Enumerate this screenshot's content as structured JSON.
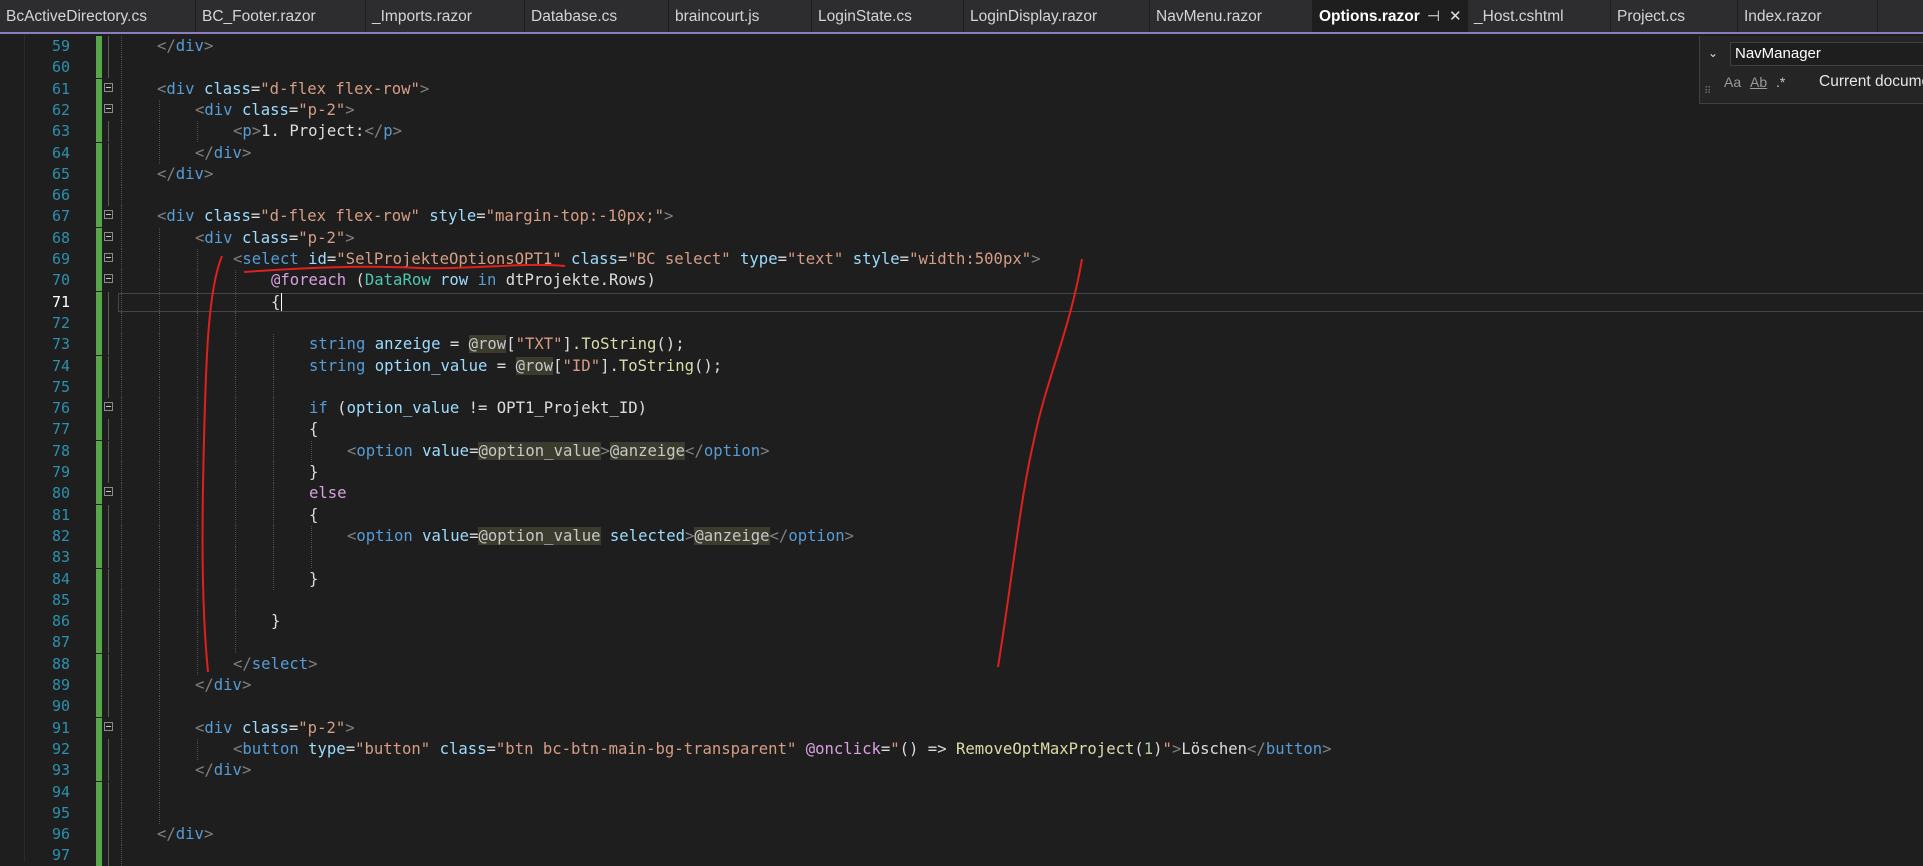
{
  "tabs": [
    {
      "label": "BcActiveDirectory.cs",
      "width": 196
    },
    {
      "label": "BC_Footer.razor",
      "width": 170
    },
    {
      "label": "_Imports.razor",
      "width": 159
    },
    {
      "label": "Database.cs",
      "width": 144
    },
    {
      "label": "braincourt.js",
      "width": 143
    },
    {
      "label": "LoginState.cs",
      "width": 152
    },
    {
      "label": "LoginDisplay.razor",
      "width": 186
    },
    {
      "label": "NavMenu.razor",
      "width": 163
    },
    {
      "label": "Options.razor",
      "width": 155,
      "active": true,
      "pin": "⊣",
      "close": "✕"
    },
    {
      "label": "_Host.cshtml",
      "width": 143
    },
    {
      "label": "Project.cs",
      "width": 127
    },
    {
      "label": "Index.razor",
      "width": 140
    }
  ],
  "find_widget": {
    "search_value": "NavManager",
    "match_case_label": "Aa",
    "whole_word_label": "Ab",
    "regex_label": ".*",
    "scope_label": "Current docume",
    "chevron": "⌄"
  },
  "editor": {
    "current_line": 71,
    "lines": [
      {
        "n": 59,
        "indent": [
          1
        ],
        "tokens": [
          [
            "t-br",
            "</"
          ],
          [
            "t-tag",
            "div"
          ],
          [
            "t-br",
            ">"
          ]
        ],
        "col": 0
      },
      {
        "n": 60,
        "indent": [
          1
        ],
        "tokens": []
      },
      {
        "n": 61,
        "indent": [
          1
        ],
        "fold": true,
        "col": 0,
        "tokens": [
          [
            "t-br",
            "<"
          ],
          [
            "t-tag",
            "div"
          ],
          [
            "t-pl",
            " "
          ],
          [
            "t-attr",
            "class"
          ],
          [
            "t-pl",
            "="
          ],
          [
            "t-str",
            "\"d-flex flex-row\""
          ],
          [
            "t-br",
            ">"
          ]
        ]
      },
      {
        "n": 62,
        "indent": [
          1,
          2
        ],
        "fold": true,
        "col": 1,
        "tokens": [
          [
            "t-br",
            "<"
          ],
          [
            "t-tag",
            "div"
          ],
          [
            "t-pl",
            " "
          ],
          [
            "t-attr",
            "class"
          ],
          [
            "t-pl",
            "="
          ],
          [
            "t-str",
            "\"p-2\""
          ],
          [
            "t-br",
            ">"
          ]
        ]
      },
      {
        "n": 63,
        "indent": [
          1,
          2,
          3
        ],
        "col": 2,
        "tokens": [
          [
            "t-br",
            "<"
          ],
          [
            "t-tag",
            "p"
          ],
          [
            "t-br",
            ">"
          ],
          [
            "t-pl",
            "1. Project:"
          ],
          [
            "t-br",
            "</"
          ],
          [
            "t-tag",
            "p"
          ],
          [
            "t-br",
            ">"
          ]
        ]
      },
      {
        "n": 64,
        "indent": [
          1,
          2
        ],
        "col": 1,
        "tokens": [
          [
            "t-br",
            "</"
          ],
          [
            "t-tag",
            "div"
          ],
          [
            "t-br",
            ">"
          ]
        ]
      },
      {
        "n": 65,
        "indent": [
          1
        ],
        "col": 0,
        "tokens": [
          [
            "t-br",
            "</"
          ],
          [
            "t-tag",
            "div"
          ],
          [
            "t-br",
            ">"
          ]
        ]
      },
      {
        "n": 66,
        "indent": [
          1
        ],
        "tokens": []
      },
      {
        "n": 67,
        "indent": [
          1
        ],
        "fold": true,
        "col": 0,
        "tokens": [
          [
            "t-br",
            "<"
          ],
          [
            "t-tag",
            "div"
          ],
          [
            "t-pl",
            " "
          ],
          [
            "t-attr",
            "class"
          ],
          [
            "t-pl",
            "="
          ],
          [
            "t-str",
            "\"d-flex flex-row\""
          ],
          [
            "t-pl",
            " "
          ],
          [
            "t-attr",
            "style"
          ],
          [
            "t-pl",
            "="
          ],
          [
            "t-str",
            "\"margin-top:-10px;\""
          ],
          [
            "t-br",
            ">"
          ]
        ]
      },
      {
        "n": 68,
        "indent": [
          1,
          2
        ],
        "fold": true,
        "col": 1,
        "tokens": [
          [
            "t-br",
            "<"
          ],
          [
            "t-tag",
            "div"
          ],
          [
            "t-pl",
            " "
          ],
          [
            "t-attr",
            "class"
          ],
          [
            "t-pl",
            "="
          ],
          [
            "t-str",
            "\"p-2\""
          ],
          [
            "t-br",
            ">"
          ]
        ]
      },
      {
        "n": 69,
        "indent": [
          1,
          2,
          3
        ],
        "fold": true,
        "col": 2,
        "tokens": [
          [
            "t-br",
            "<"
          ],
          [
            "t-tag",
            "select"
          ],
          [
            "t-pl",
            " "
          ],
          [
            "t-attr",
            "id"
          ],
          [
            "t-pl",
            "="
          ],
          [
            "t-str",
            "\"SelProjekteOptionsOPT1\""
          ],
          [
            "t-pl",
            " "
          ],
          [
            "t-attr",
            "class"
          ],
          [
            "t-pl",
            "="
          ],
          [
            "t-str",
            "\"BC select\""
          ],
          [
            "t-pl",
            " "
          ],
          [
            "t-attr",
            "type"
          ],
          [
            "t-pl",
            "="
          ],
          [
            "t-str",
            "\"text\""
          ],
          [
            "t-pl",
            " "
          ],
          [
            "t-attr",
            "style"
          ],
          [
            "t-pl",
            "="
          ],
          [
            "t-str",
            "\"width:500px\""
          ],
          [
            "t-br",
            ">"
          ]
        ]
      },
      {
        "n": 70,
        "indent": [
          1,
          2,
          3,
          4
        ],
        "fold": true,
        "col": 3,
        "tokens": [
          [
            "t-ctl",
            "@foreach"
          ],
          [
            "t-pl",
            " ("
          ],
          [
            "t-type",
            "DataRow"
          ],
          [
            "t-pl",
            " "
          ],
          [
            "t-attr",
            "row"
          ],
          [
            "t-pl",
            " "
          ],
          [
            "t-kw",
            "in"
          ],
          [
            "t-pl",
            " dtProjekte.Rows)"
          ]
        ]
      },
      {
        "n": 71,
        "indent": [
          1,
          2,
          3,
          4
        ],
        "col": 3,
        "tokens": [
          [
            "t-pl",
            "{"
          ]
        ]
      },
      {
        "n": 72,
        "indent": [
          1,
          2,
          3,
          4
        ],
        "tokens": []
      },
      {
        "n": 73,
        "indent": [
          1,
          2,
          3,
          4,
          5
        ],
        "col": 4,
        "tokens": [
          [
            "t-kw",
            "string"
          ],
          [
            "t-pl",
            " "
          ],
          [
            "t-attr",
            "anzeige"
          ],
          [
            "t-pl",
            " = "
          ],
          [
            "t-razor",
            "@row"
          ],
          [
            "t-pl",
            "["
          ],
          [
            "t-str",
            "\"TXT\""
          ],
          [
            "t-pl",
            "]."
          ],
          [
            "t-fn",
            "ToString"
          ],
          [
            "t-pl",
            "();"
          ]
        ]
      },
      {
        "n": 74,
        "indent": [
          1,
          2,
          3,
          4,
          5
        ],
        "col": 4,
        "tokens": [
          [
            "t-kw",
            "string"
          ],
          [
            "t-pl",
            " "
          ],
          [
            "t-attr",
            "option_value"
          ],
          [
            "t-pl",
            " = "
          ],
          [
            "t-razor",
            "@row"
          ],
          [
            "t-pl",
            "["
          ],
          [
            "t-str",
            "\"ID\""
          ],
          [
            "t-pl",
            "]."
          ],
          [
            "t-fn",
            "ToString"
          ],
          [
            "t-pl",
            "();"
          ]
        ]
      },
      {
        "n": 75,
        "indent": [
          1,
          2,
          3,
          4,
          5
        ],
        "tokens": []
      },
      {
        "n": 76,
        "indent": [
          1,
          2,
          3,
          4,
          5
        ],
        "fold": true,
        "col": 4,
        "tokens": [
          [
            "t-kw",
            "if"
          ],
          [
            "t-pl",
            " ("
          ],
          [
            "t-attr",
            "option_value"
          ],
          [
            "t-pl",
            " != OPT1_Projekt_ID)"
          ]
        ]
      },
      {
        "n": 77,
        "indent": [
          1,
          2,
          3,
          4,
          5
        ],
        "col": 4,
        "tokens": [
          [
            "t-pl",
            "{"
          ]
        ]
      },
      {
        "n": 78,
        "indent": [
          1,
          2,
          3,
          4,
          5,
          6
        ],
        "col": 5,
        "tokens": [
          [
            "t-br",
            "<"
          ],
          [
            "t-tag",
            "option"
          ],
          [
            "t-pl",
            " "
          ],
          [
            "t-attr",
            "value"
          ],
          [
            "t-pl",
            "="
          ],
          [
            "t-razor",
            "@option_value"
          ],
          [
            "t-br",
            ">"
          ],
          [
            "t-razor",
            "@anzeige"
          ],
          [
            "t-br",
            "</"
          ],
          [
            "t-tag",
            "option"
          ],
          [
            "t-br",
            ">"
          ]
        ]
      },
      {
        "n": 79,
        "indent": [
          1,
          2,
          3,
          4,
          5
        ],
        "col": 4,
        "tokens": [
          [
            "t-pl",
            "}"
          ]
        ]
      },
      {
        "n": 80,
        "indent": [
          1,
          2,
          3,
          4,
          5
        ],
        "fold": true,
        "col": 4,
        "tokens": [
          [
            "t-ctl",
            "else"
          ]
        ]
      },
      {
        "n": 81,
        "indent": [
          1,
          2,
          3,
          4,
          5
        ],
        "col": 4,
        "tokens": [
          [
            "t-pl",
            "{"
          ]
        ]
      },
      {
        "n": 82,
        "indent": [
          1,
          2,
          3,
          4,
          5,
          6
        ],
        "col": 5,
        "tokens": [
          [
            "t-br",
            "<"
          ],
          [
            "t-tag",
            "option"
          ],
          [
            "t-pl",
            " "
          ],
          [
            "t-attr",
            "value"
          ],
          [
            "t-pl",
            "="
          ],
          [
            "t-razor",
            "@option_value"
          ],
          [
            "t-pl",
            " "
          ],
          [
            "t-attr",
            "selected"
          ],
          [
            "t-br",
            ">"
          ],
          [
            "t-razor",
            "@anzeige"
          ],
          [
            "t-br",
            "</"
          ],
          [
            "t-tag",
            "option"
          ],
          [
            "t-br",
            ">"
          ]
        ]
      },
      {
        "n": 83,
        "indent": [
          1,
          2,
          3,
          4,
          5,
          6
        ],
        "tokens": []
      },
      {
        "n": 84,
        "indent": [
          1,
          2,
          3,
          4,
          5
        ],
        "col": 4,
        "tokens": [
          [
            "t-pl",
            "}"
          ]
        ]
      },
      {
        "n": 85,
        "indent": [
          1,
          2,
          3,
          4
        ],
        "tokens": []
      },
      {
        "n": 86,
        "indent": [
          1,
          2,
          3,
          4
        ],
        "col": 3,
        "tokens": [
          [
            "t-pl",
            "}"
          ]
        ]
      },
      {
        "n": 87,
        "indent": [
          1,
          2,
          3,
          4
        ],
        "tokens": []
      },
      {
        "n": 88,
        "indent": [
          1,
          2,
          3
        ],
        "col": 2,
        "tokens": [
          [
            "t-br",
            "</"
          ],
          [
            "t-tag",
            "select"
          ],
          [
            "t-br",
            ">"
          ]
        ]
      },
      {
        "n": 89,
        "indent": [
          1,
          2
        ],
        "col": 1,
        "tokens": [
          [
            "t-br",
            "</"
          ],
          [
            "t-tag",
            "div"
          ],
          [
            "t-br",
            ">"
          ]
        ]
      },
      {
        "n": 90,
        "indent": [
          1,
          2
        ],
        "tokens": []
      },
      {
        "n": 91,
        "indent": [
          1,
          2
        ],
        "fold": true,
        "col": 1,
        "tokens": [
          [
            "t-br",
            "<"
          ],
          [
            "t-tag",
            "div"
          ],
          [
            "t-pl",
            " "
          ],
          [
            "t-attr",
            "class"
          ],
          [
            "t-pl",
            "="
          ],
          [
            "t-str",
            "\"p-2\""
          ],
          [
            "t-br",
            ">"
          ]
        ]
      },
      {
        "n": 92,
        "indent": [
          1,
          2,
          3
        ],
        "col": 2,
        "tokens": [
          [
            "t-br",
            "<"
          ],
          [
            "t-tag",
            "button"
          ],
          [
            "t-pl",
            " "
          ],
          [
            "t-attr",
            "type"
          ],
          [
            "t-pl",
            "="
          ],
          [
            "t-str",
            "\"button\""
          ],
          [
            "t-pl",
            " "
          ],
          [
            "t-attr",
            "class"
          ],
          [
            "t-pl",
            "="
          ],
          [
            "t-str",
            "\"btn bc-btn-main-bg-transparent\""
          ],
          [
            "t-pl",
            " "
          ],
          [
            "t-ctl",
            "@onclick"
          ],
          [
            "t-pl",
            "="
          ],
          [
            "t-str",
            "\""
          ],
          [
            "t-pl",
            "() => "
          ],
          [
            "t-fn",
            "RemoveOptMaxProject"
          ],
          [
            "t-pl",
            "("
          ],
          [
            "t-num",
            "1"
          ],
          [
            "t-pl",
            ")"
          ],
          [
            "t-str",
            "\""
          ],
          [
            "t-br",
            ">"
          ],
          [
            "t-pl",
            "Löschen"
          ],
          [
            "t-br",
            "</"
          ],
          [
            "t-tag",
            "button"
          ],
          [
            "t-br",
            ">"
          ]
        ]
      },
      {
        "n": 93,
        "indent": [
          1,
          2
        ],
        "col": 1,
        "tokens": [
          [
            "t-br",
            "</"
          ],
          [
            "t-tag",
            "div"
          ],
          [
            "t-br",
            ">"
          ]
        ]
      },
      {
        "n": 94,
        "indent": [
          1,
          2
        ],
        "tokens": []
      },
      {
        "n": 95,
        "indent": [
          1,
          2
        ],
        "tokens": []
      },
      {
        "n": 96,
        "indent": [
          1
        ],
        "col": 0,
        "tokens": [
          [
            "t-br",
            "</"
          ],
          [
            "t-tag",
            "div"
          ],
          [
            "t-br",
            ">"
          ]
        ]
      },
      {
        "n": 97,
        "indent": [
          1
        ],
        "tokens": []
      }
    ]
  },
  "colors": {
    "background": "#1e1e1e",
    "line_number": "#2b91af",
    "change_bar": "#57a64a",
    "annotation": "#e0201c"
  }
}
